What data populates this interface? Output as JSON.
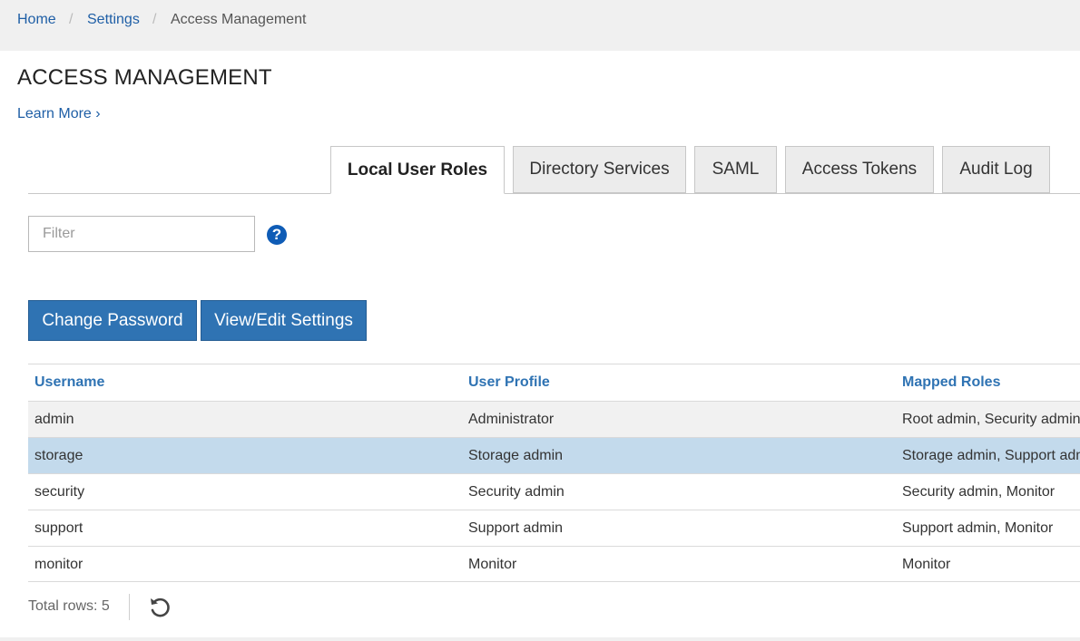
{
  "breadcrumb": {
    "items": [
      "Home",
      "Settings",
      "Access Management"
    ],
    "separator": "/"
  },
  "page": {
    "title": "ACCESS MANAGEMENT",
    "learn_more": "Learn More ›"
  },
  "tabs": [
    {
      "label": "Local User Roles",
      "active": true
    },
    {
      "label": "Directory Services",
      "active": false
    },
    {
      "label": "SAML",
      "active": false
    },
    {
      "label": "Access Tokens",
      "active": false
    },
    {
      "label": "Audit Log",
      "active": false
    }
  ],
  "filter": {
    "placeholder": "Filter",
    "value": ""
  },
  "help": {
    "icon": "help-icon",
    "glyph": "?"
  },
  "toolbar": {
    "change_password": "Change Password",
    "view_edit_settings": "View/Edit Settings"
  },
  "table": {
    "columns": [
      "Username",
      "User Profile",
      "Mapped Roles"
    ],
    "rows": [
      [
        "admin",
        "Administrator",
        "Root admin, Security admin"
      ],
      [
        "storage",
        "Storage admin",
        "Storage admin, Support admin"
      ],
      [
        "security",
        "Security admin",
        "Security admin, Monitor"
      ],
      [
        "support",
        "Support admin",
        "Support admin, Monitor"
      ],
      [
        "monitor",
        "Monitor",
        "Monitor"
      ]
    ],
    "selected_row": "storage"
  },
  "footer": {
    "total_rows": "Total rows: 5",
    "refresh_icon": "refresh-icon"
  },
  "colors": {
    "accent": "#2f73b3",
    "link": "#1f5fa6",
    "selected_row": "#c3daec",
    "help_icon": "#0f5cb6"
  }
}
